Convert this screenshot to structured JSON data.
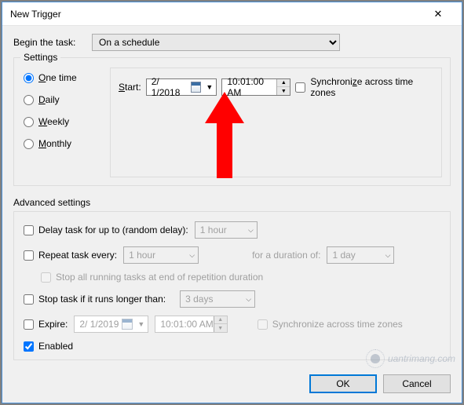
{
  "window": {
    "title": "New Trigger"
  },
  "begin": {
    "label": "Begin the task:",
    "value": "On a schedule"
  },
  "settings": {
    "legend": "Settings",
    "radios": {
      "onetime": "One time",
      "daily": "Daily",
      "weekly": "Weekly",
      "monthly": "Monthly"
    },
    "start_label": "Start:",
    "start_date": "2/  1/2018",
    "start_time": "10:01:00 AM",
    "sync_label": "Synchronize across time zones"
  },
  "advanced": {
    "legend": "Advanced settings",
    "delay_label": "Delay task for up to (random delay):",
    "delay_value": "1 hour",
    "repeat_label": "Repeat task every:",
    "repeat_value": "1 hour",
    "duration_label": "for a duration of:",
    "duration_value": "1 day",
    "stop_rep_label": "Stop all running tasks at end of repetition duration",
    "stop_long_label": "Stop task if it runs longer than:",
    "stop_long_value": "3 days",
    "expire_label": "Expire:",
    "expire_date": "2/  1/2019",
    "expire_time": "10:01:00 AM",
    "expire_sync": "Synchronize across time zones",
    "enabled_label": "Enabled"
  },
  "buttons": {
    "ok": "OK",
    "cancel": "Cancel"
  },
  "watermark": "uantrimang.com"
}
